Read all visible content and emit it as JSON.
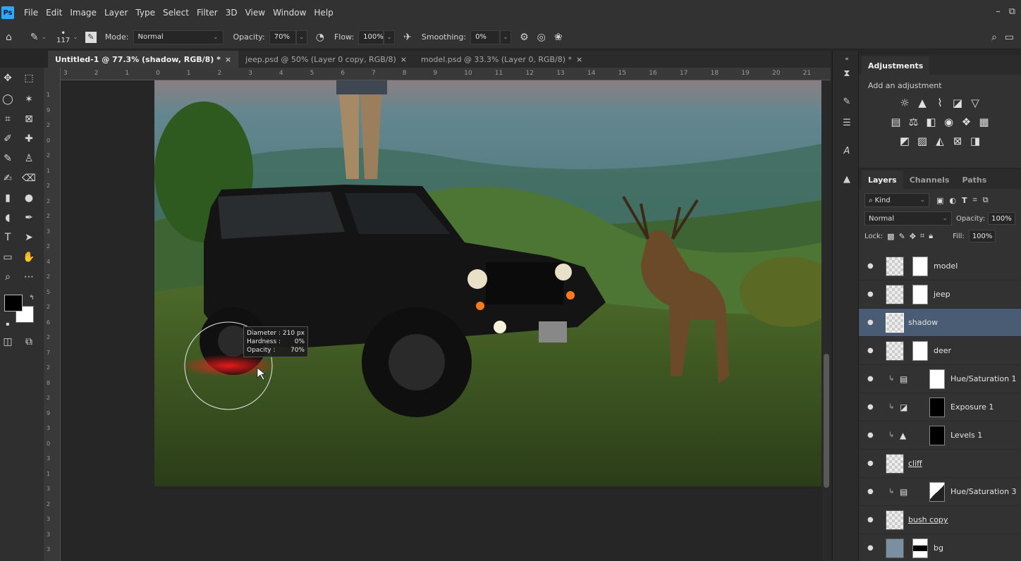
{
  "app": {
    "logo": "Ps",
    "menu": [
      "File",
      "Edit",
      "Image",
      "Layer",
      "Type",
      "Select",
      "Filter",
      "3D",
      "View",
      "Window",
      "Help"
    ]
  },
  "options_bar": {
    "brush_size": "117",
    "mode_label": "Mode:",
    "mode_value": "Normal",
    "opacity_label": "Opacity:",
    "opacity_value": "70%",
    "flow_label": "Flow:",
    "flow_value": "100%",
    "smoothing_label": "Smoothing:",
    "smoothing_value": "0%"
  },
  "tabs": [
    {
      "label": "Untitled-1 @ 77.3% (shadow, RGB/8) *",
      "active": true
    },
    {
      "label": "jeep.psd @ 50% (Layer 0 copy, RGB/8)",
      "active": false
    },
    {
      "label": "model.psd @ 33.3% (Layer 0, RGB/8) *",
      "active": false
    }
  ],
  "ruler": {
    "top": [
      "3",
      "2",
      "1",
      "0",
      "1",
      "2",
      "3",
      "4",
      "5",
      "6",
      "7",
      "8",
      "9",
      "10",
      "11",
      "12",
      "13",
      "14",
      "15",
      "16",
      "17",
      "18",
      "19",
      "20",
      "21"
    ],
    "left": [
      "1",
      "9",
      "2",
      "0",
      "2",
      "1",
      "2",
      "2",
      "2",
      "3",
      "2",
      "4",
      "2",
      "5",
      "2",
      "6",
      "2",
      "7",
      "2",
      "8",
      "2",
      "9",
      "3",
      "0",
      "3",
      "1",
      "3",
      "2",
      "3",
      "3",
      "3"
    ]
  },
  "brush_tooltip": {
    "diameter_label": "Diameter :",
    "diameter_value": "210 px",
    "hardness_label": "Hardness :",
    "hardness_value": "0%",
    "opacity_label": "Opacity :",
    "opacity_value": "70%"
  },
  "adjustments": {
    "tab": "Adjustments",
    "hint": "Add an adjustment"
  },
  "layers_panel": {
    "tabs": [
      "Layers",
      "Channels",
      "Paths"
    ],
    "filter_kind": "Kind",
    "blend_mode": "Normal",
    "opacity_label": "Opacity:",
    "opacity_value": "100%",
    "lock_label": "Lock:",
    "fill_label": "Fill:",
    "fill_value": "100%",
    "layers": [
      {
        "name": "model",
        "type": "pixel",
        "mask": "white",
        "selected": false
      },
      {
        "name": "jeep",
        "type": "pixel",
        "mask": "white",
        "selected": false
      },
      {
        "name": "shadow",
        "type": "pixel",
        "mask": "none",
        "selected": true
      },
      {
        "name": "deer",
        "type": "pixel",
        "mask": "white",
        "selected": false
      },
      {
        "name": "Hue/Saturation 1",
        "type": "adjustment",
        "icon": "hue-saturation-icon",
        "mask": "white",
        "clipped": true,
        "selected": false
      },
      {
        "name": "Exposure 1",
        "type": "adjustment",
        "icon": "exposure-icon",
        "mask": "black",
        "clipped": true,
        "selected": false
      },
      {
        "name": "Levels 1",
        "type": "adjustment",
        "icon": "levels-icon",
        "mask": "black",
        "clipped": true,
        "selected": false
      },
      {
        "name": "cliff",
        "type": "pixel",
        "mask": "none",
        "selected": false
      },
      {
        "name": "Hue/Saturation 3",
        "type": "adjustment",
        "icon": "hue-saturation-icon",
        "mask": "half",
        "clipped": true,
        "selected": false
      },
      {
        "name": "bush copy",
        "type": "pixel",
        "mask": "none",
        "selected": false
      },
      {
        "name": "bg",
        "type": "pixel",
        "mask": "black",
        "selected": false
      }
    ]
  },
  "colors": {
    "foreground": "#000000",
    "background": "#ffffff",
    "selection": "#4a5c74",
    "accent": "#31a8ff"
  }
}
